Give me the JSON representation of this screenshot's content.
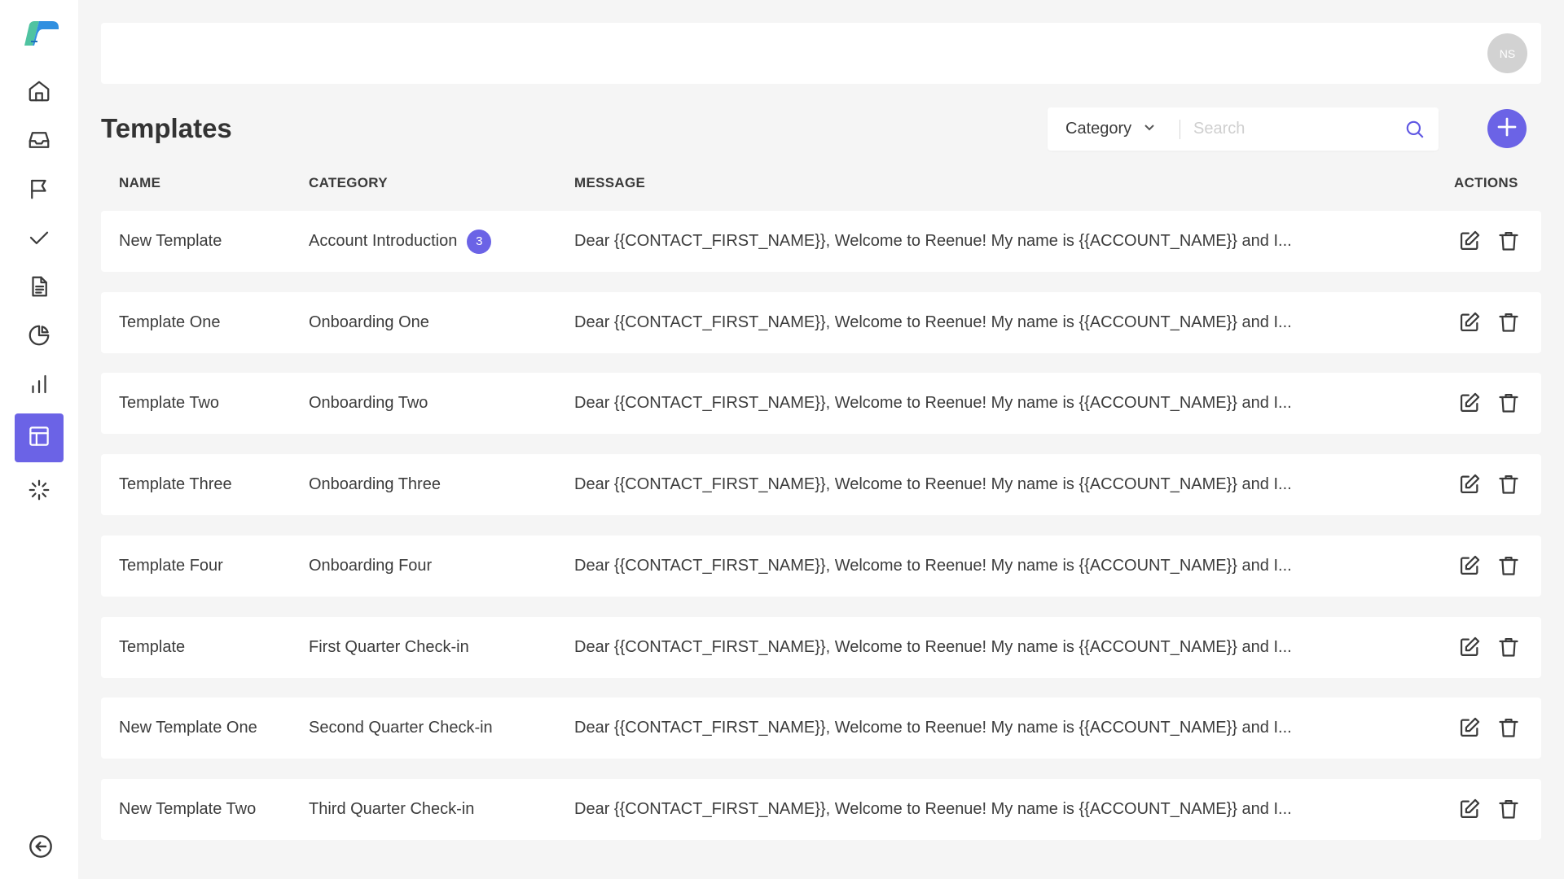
{
  "colors": {
    "accent": "#6b63e6",
    "background": "#f5f5f5",
    "card": "#ffffff"
  },
  "sidebar": {
    "logo_icon": "brand-logo-icon",
    "items": [
      {
        "icon": "home-icon",
        "active": false
      },
      {
        "icon": "inbox-icon",
        "active": false
      },
      {
        "icon": "flag-icon",
        "active": false
      },
      {
        "icon": "check-icon",
        "active": false
      },
      {
        "icon": "document-icon",
        "active": false
      },
      {
        "icon": "pie-chart-icon",
        "active": false
      },
      {
        "icon": "bar-chart-icon",
        "active": false
      },
      {
        "icon": "template-icon",
        "active": true
      },
      {
        "icon": "loader-icon",
        "active": false
      }
    ],
    "collapse_icon": "arrow-left-circle-icon"
  },
  "header": {
    "avatar_initials": "NS"
  },
  "page": {
    "title": "Templates"
  },
  "filters": {
    "category_label": "Category",
    "search_placeholder": "Search"
  },
  "table": {
    "columns": {
      "name": "NAME",
      "category": "CATEGORY",
      "message": "MESSAGE",
      "actions": "ACTIONS"
    },
    "rows": [
      {
        "name": "New Template",
        "category": "Account Introduction",
        "badge": "3",
        "message": "Dear {{CONTACT_FIRST_NAME}}, Welcome to Reenue! My name is {{ACCOUNT_NAME}} and I..."
      },
      {
        "name": "Template One",
        "category": "Onboarding One",
        "badge": "",
        "message": "Dear {{CONTACT_FIRST_NAME}}, Welcome to Reenue! My name is {{ACCOUNT_NAME}} and I..."
      },
      {
        "name": "Template Two",
        "category": "Onboarding Two",
        "badge": "",
        "message": "Dear {{CONTACT_FIRST_NAME}}, Welcome to Reenue! My name is {{ACCOUNT_NAME}} and I..."
      },
      {
        "name": "Template Three",
        "category": "Onboarding Three",
        "badge": "",
        "message": "Dear {{CONTACT_FIRST_NAME}}, Welcome to Reenue! My name is {{ACCOUNT_NAME}} and I..."
      },
      {
        "name": "Template Four",
        "category": "Onboarding Four",
        "badge": "",
        "message": "Dear {{CONTACT_FIRST_NAME}}, Welcome to Reenue! My name is {{ACCOUNT_NAME}} and I..."
      },
      {
        "name": "Template",
        "category": "First Quarter Check-in",
        "badge": "",
        "message": "Dear {{CONTACT_FIRST_NAME}}, Welcome to Reenue! My name is {{ACCOUNT_NAME}} and I..."
      },
      {
        "name": "New Template One",
        "category": "Second Quarter Check-in",
        "badge": "",
        "message": "Dear {{CONTACT_FIRST_NAME}}, Welcome to Reenue! My name is {{ACCOUNT_NAME}} and I..."
      },
      {
        "name": "New Template Two",
        "category": "Third Quarter Check-in",
        "badge": "",
        "message": "Dear {{CONTACT_FIRST_NAME}}, Welcome to Reenue! My name is {{ACCOUNT_NAME}} and I..."
      }
    ]
  }
}
